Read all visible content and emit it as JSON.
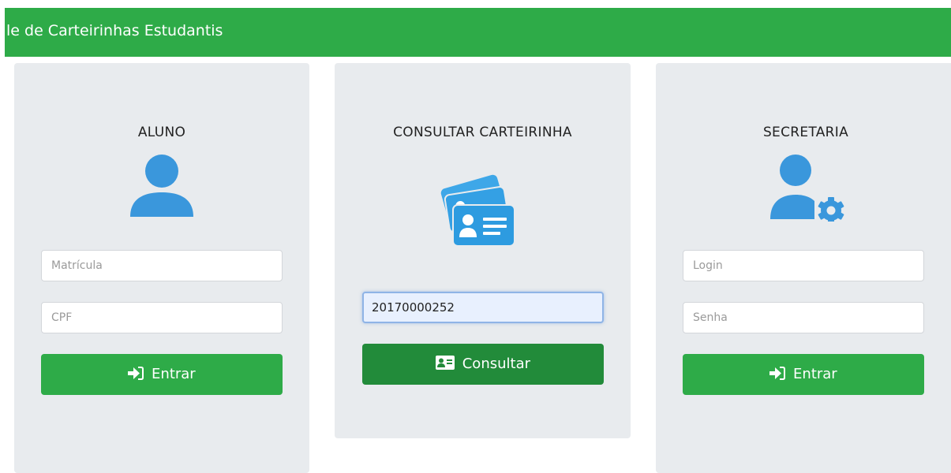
{
  "header": {
    "title": "le de Carteirinhas Estudantis"
  },
  "aluno": {
    "heading": "ALUNO",
    "matricula_placeholder": "Matrícula",
    "cpf_placeholder": "CPF",
    "button_label": "Entrar"
  },
  "consulta": {
    "heading": "CONSULTAR CARTEIRINHA",
    "input_value": "20170000252",
    "button_label": "Consultar"
  },
  "secretaria": {
    "heading": "SECRETARIA",
    "login_placeholder": "Login",
    "senha_placeholder": "Senha",
    "button_label": "Entrar"
  },
  "colors": {
    "brand_green": "#2eab48",
    "dark_green": "#228b3a",
    "icon_blue": "#3a97dc",
    "panel_bg": "#e8ebee"
  },
  "icons": [
    "user-icon",
    "id-cards-icon",
    "user-gear-icon",
    "sign-in-icon",
    "id-card-icon"
  ]
}
